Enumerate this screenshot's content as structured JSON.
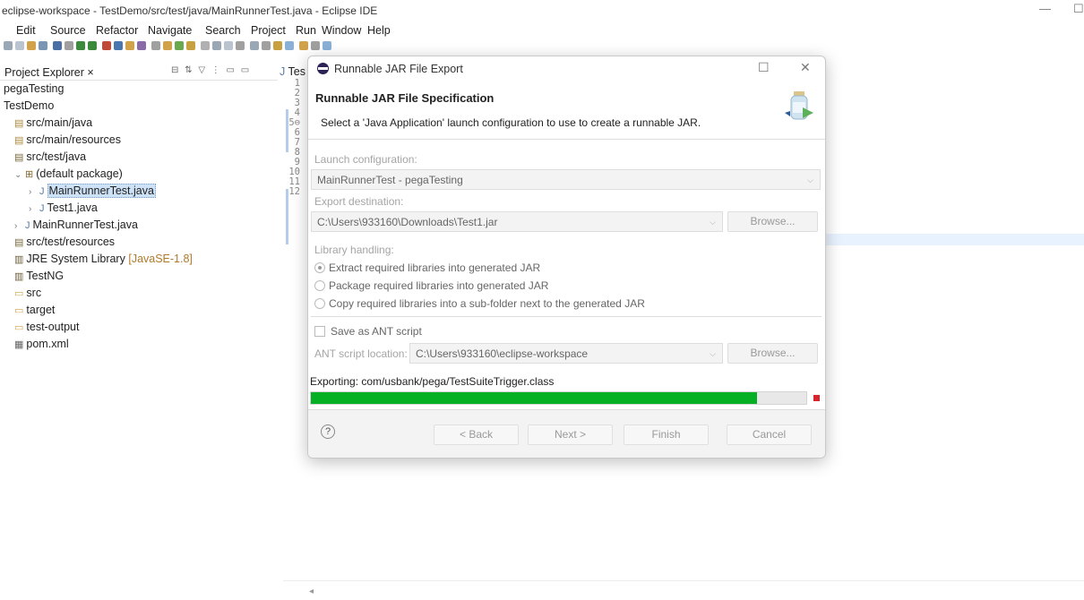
{
  "window": {
    "title": "eclipse-workspace - TestDemo/src/test/java/MainRunnerTest.java - Eclipse IDE",
    "minimize": "—",
    "restore": "☐"
  },
  "menu": [
    "Edit",
    "Source",
    "Refactor",
    "Navigate",
    "Search",
    "Project",
    "Run",
    "Window",
    "Help"
  ],
  "explorer": {
    "tab_label": "Project Explorer ×",
    "tools": "⊟ ⇅ ▽ ⋮ ▭ ▭",
    "items": [
      {
        "label": "pegaTesting",
        "icon": "▸"
      },
      {
        "label": "TestDemo",
        "icon": "▸"
      },
      {
        "label": "src/main/java",
        "icon": "▤"
      },
      {
        "label": "src/main/resources",
        "icon": "▤"
      },
      {
        "label": "src/test/java",
        "icon": "▤"
      },
      {
        "label": "(default package)",
        "icon": "⊞"
      },
      {
        "label": "MainRunnerTest.java",
        "icon": "J"
      },
      {
        "label": "Test1.java",
        "icon": "J"
      },
      {
        "label": "MainRunnerTest.java",
        "icon": "J"
      },
      {
        "label": "src/test/resources",
        "icon": "▤"
      },
      {
        "label": "JRE System Library",
        "suffix": "[JavaSE-1.8]",
        "icon": "▥"
      },
      {
        "label": "TestNG",
        "icon": "▥"
      },
      {
        "label": "src",
        "icon": "▭"
      },
      {
        "label": "target",
        "icon": "▭"
      },
      {
        "label": "test-output",
        "icon": "▭"
      },
      {
        "label": "pom.xml",
        "icon": "▦"
      }
    ]
  },
  "editor": {
    "tab_label": "Tes",
    "line_numbers": [
      "1",
      "2",
      "3",
      "4",
      "5⊖",
      "6",
      "7",
      "8",
      "9",
      "10",
      "11",
      "12"
    ],
    "scroll_left": "◂"
  },
  "dialog": {
    "title": "Runnable JAR File Export",
    "maximize": "☐",
    "close": "✕",
    "heading": "Runnable JAR File Specification",
    "description": "Select a 'Java Application' launch configuration to use to create a runnable JAR.",
    "launch_label": "Launch configuration:",
    "launch_value": "MainRunnerTest - pegaTesting",
    "export_label": "Export destination:",
    "export_value": "C:\\Users\\933160\\Downloads\\Test1.jar",
    "browse": "Browse...",
    "library_label": "Library handling:",
    "library_options": [
      {
        "label": "Extract required libraries into generated JAR",
        "selected": true
      },
      {
        "label": "Package required libraries into generated JAR",
        "selected": false
      },
      {
        "label": "Copy required libraries into a sub-folder next to the generated JAR",
        "selected": false
      }
    ],
    "save_ant": "Save as ANT script",
    "ant_label": "ANT script location:",
    "ant_value": "C:\\Users\\933160\\eclipse-workspace",
    "progress_text": "Exporting: com/usbank/pega/TestSuiteTrigger.class",
    "progress_fraction": 0.9,
    "help": "?",
    "back": "< Back",
    "next": "Next >",
    "finish": "Finish",
    "cancel": "Cancel"
  },
  "colors": {
    "progress_fill": "#06b025",
    "selection": "#cde2f7",
    "stop": "#d9242d"
  }
}
